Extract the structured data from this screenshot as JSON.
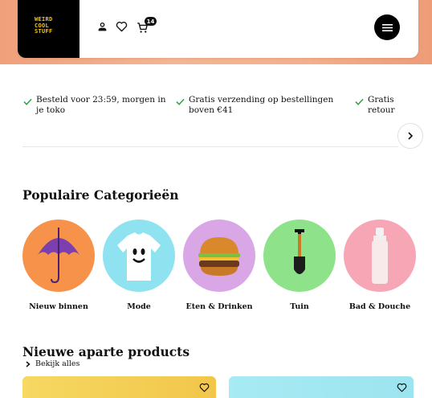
{
  "header": {
    "logo_lines": [
      "WEIRD",
      "COOL",
      "STUFF"
    ],
    "cart_count": "14"
  },
  "usps": [
    {
      "text": "Besteld voor 23:59, morgen in je toko"
    },
    {
      "text": "Gratis verzending op bestellingen boven €41"
    },
    {
      "text": "Gratis retour"
    }
  ],
  "categories": {
    "title": "Populaire Categorieën",
    "items": [
      {
        "label": "Nieuw binnen",
        "bg": "#f7924a"
      },
      {
        "label": "Mode",
        "bg": "#8fe3f0"
      },
      {
        "label": "Eten & Drinken",
        "bg": "#d9a6e6"
      },
      {
        "label": "Tuin",
        "bg": "#8ee38a"
      },
      {
        "label": "Bad & Douche",
        "bg": "#f7a6b6"
      }
    ]
  },
  "products": {
    "title": "Nieuwe aparte products",
    "see_all": "Bekijk alles",
    "cards": [
      {
        "bg": "#f4cf58"
      },
      {
        "bg": "#a7ebf4"
      }
    ]
  },
  "colors": {
    "accent_check": "#2f9e44",
    "logo_yellow": "#f5c518"
  }
}
